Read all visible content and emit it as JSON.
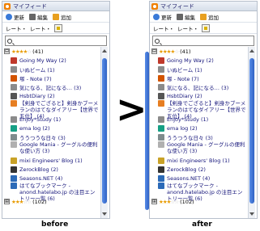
{
  "arrow": ">",
  "captions": {
    "before": "before",
    "after": "after"
  },
  "panel": {
    "title": "マイフィード",
    "toolbar": {
      "refresh": "更新",
      "edit": "編集",
      "add": "追加"
    },
    "toolbar2": {
      "sort1": "レート・",
      "sort2": "レート・"
    },
    "search_value": "",
    "group_top": {
      "expander": "⊟",
      "stars": "★★★★",
      "stars_off": "☆",
      "count": "(41)"
    },
    "items": [
      {
        "label": "Going My Way (2)",
        "color": "#c0392b"
      },
      {
        "label": "いぬビーム (1)",
        "color": "#8b8b8b"
      },
      {
        "label": "塚 - Note (7)",
        "color": "#d35400"
      },
      {
        "label": "気になる、記になる… (3)",
        "color": "#8b8b8b"
      },
      {
        "label": "HsbtDiary (2)",
        "color": "#555555"
      },
      {
        "label": "【剣身でござると】剣身かブーメランのはてなダイアリー【世界で五位】 (4)",
        "color": "#e67e22",
        "tall": true
      },
      {
        "label": "Enjoy*Study (1)",
        "color": "#8b8b8b"
      },
      {
        "label": "ema log (2)",
        "color": "#16a085"
      },
      {
        "label": "ううつうな日々 (3)",
        "color": "#7f8c8d"
      },
      {
        "label": "Google Mania - グーグルの便利な使い方 (3)",
        "color": "#b0b0b0",
        "tall": true
      },
      {
        "label": "mixi Engineers' Blog (1)",
        "color": "#c9a227"
      },
      {
        "label": "ZerockBlog (2)",
        "color": "#333333"
      },
      {
        "label": "Seasons.NET (4)",
        "color": "#2c6bb8"
      },
      {
        "label": "はてなブックマーク - anond.hatelabo.jp の注目エントリー一覧 (6)",
        "color": "#2c6bb8",
        "tall": true
      }
    ],
    "group_bottom": {
      "expander": "⊞",
      "stars": "★★★",
      "stars_off": "☆☆",
      "count": "(102)"
    }
  }
}
